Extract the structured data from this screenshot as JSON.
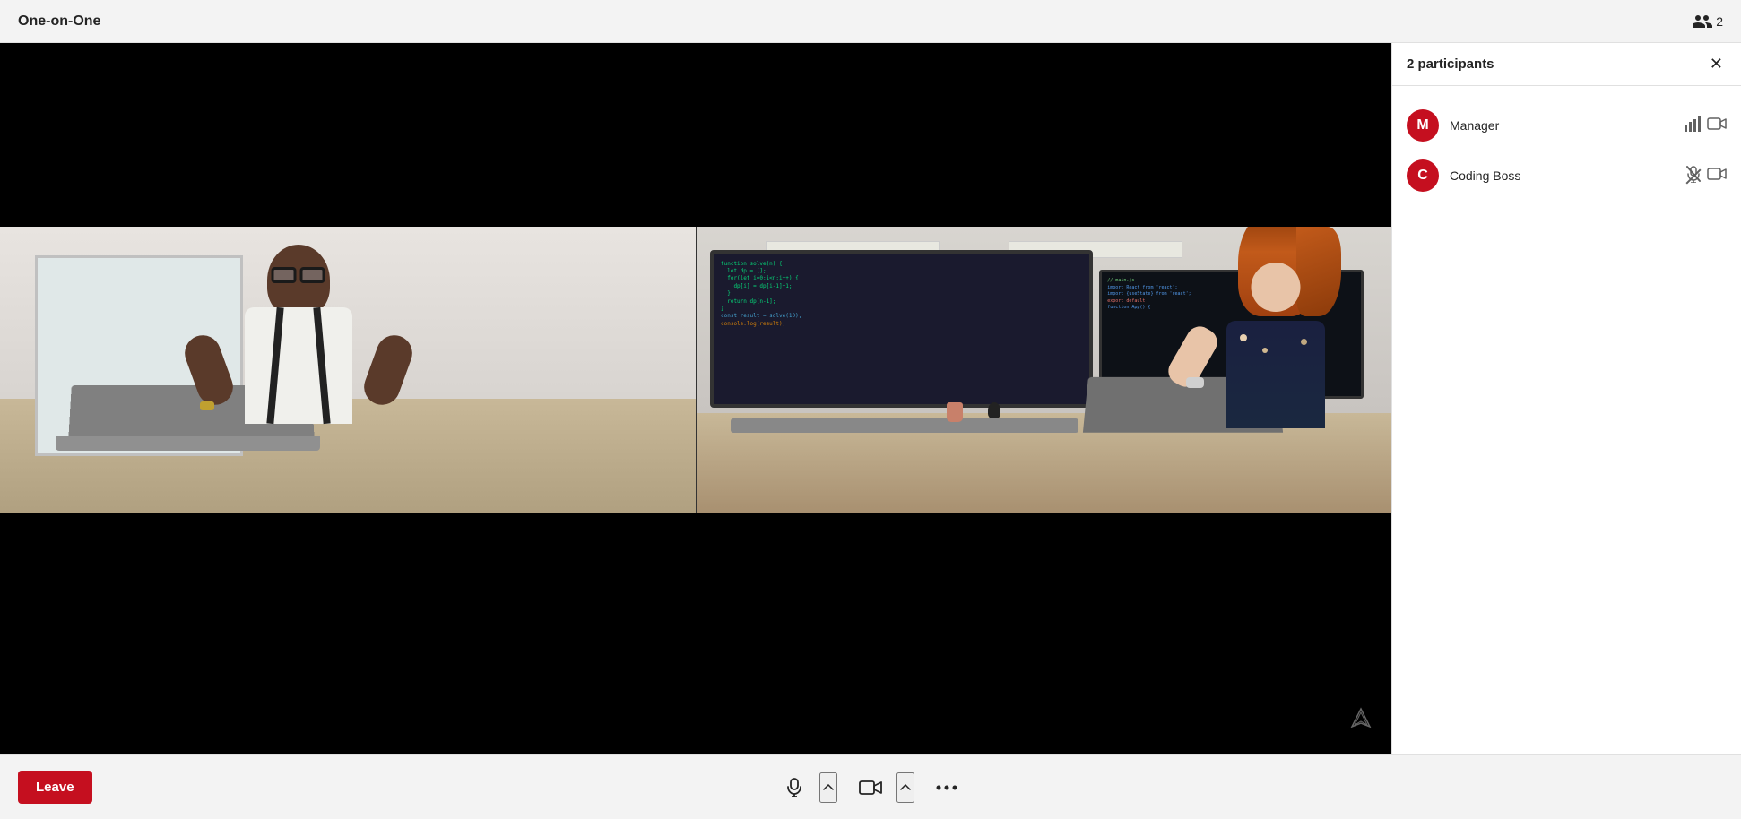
{
  "topBar": {
    "title": "One-on-One",
    "participantsCount": "2"
  },
  "participants": {
    "header": "2 participants",
    "list": [
      {
        "id": "manager",
        "initial": "M",
        "name": "Manager",
        "avatarColor": "#c50f1f",
        "micMuted": false,
        "camMuted": false
      },
      {
        "id": "coding-boss",
        "initial": "C",
        "name": "Coding Boss",
        "avatarColor": "#c50f1f",
        "micMuted": true,
        "camMuted": false
      }
    ]
  },
  "controls": {
    "leaveLabel": "Leave",
    "micLabel": "Microphone",
    "cameraLabel": "Camera",
    "moreLabel": "More options"
  },
  "icons": {
    "participantsIcon": "👥",
    "micIcon": "🎤",
    "cameraIcon": "📷",
    "moreIcon": "•••",
    "closeIcon": "✕",
    "chevronUp": "^",
    "signalIcon": "⬡",
    "barChartIcon": "📊",
    "videoIcon": "📹"
  }
}
